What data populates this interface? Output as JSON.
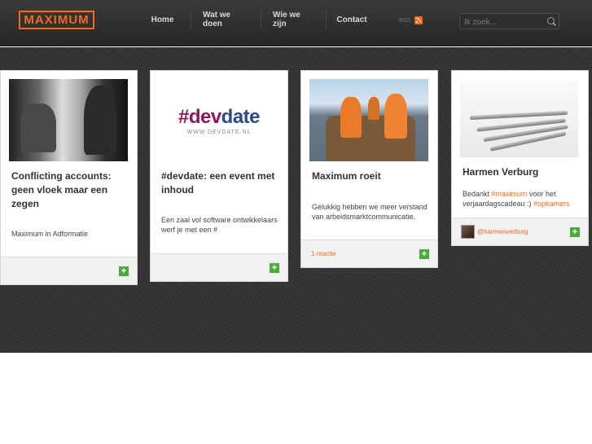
{
  "header": {
    "logo": "MAXIMUM",
    "nav": [
      "Home",
      "Wat we doen",
      "Wie we zijn",
      "Contact"
    ],
    "rss_label": "RSS",
    "search_placeholder": "Ik zoek..."
  },
  "colors": {
    "accent": "#f26a1b",
    "plus": "#4caa3c"
  },
  "cards": [
    {
      "title": "Conflicting accounts: geen vloek maar een zegen",
      "text": "Maximum in Adformatie",
      "plus": "+"
    },
    {
      "title": "#devdate: een event met inhoud",
      "text": "Een zaal vol software ontwikkelaars werf je met een #",
      "logo_main": "#dev",
      "logo_rest": "date",
      "logo_sub": "WWW.DEVDATE.NL",
      "plus": "+"
    },
    {
      "title": "Maximum roeit",
      "text": "Gelukkig hebben we meer verstand van arbeidsmarktcommunicatie.",
      "footer_link": "1 reactie",
      "plus": "+"
    },
    {
      "title": "Harmen Verburg",
      "text_pre": "Bedankt ",
      "text_hl1": "#maximum",
      "text_mid": " voor het verjaardagscadeau :) ",
      "text_hl2": "#opkamers",
      "twitter_handle": "@harmenverburg",
      "plus": "+"
    }
  ]
}
